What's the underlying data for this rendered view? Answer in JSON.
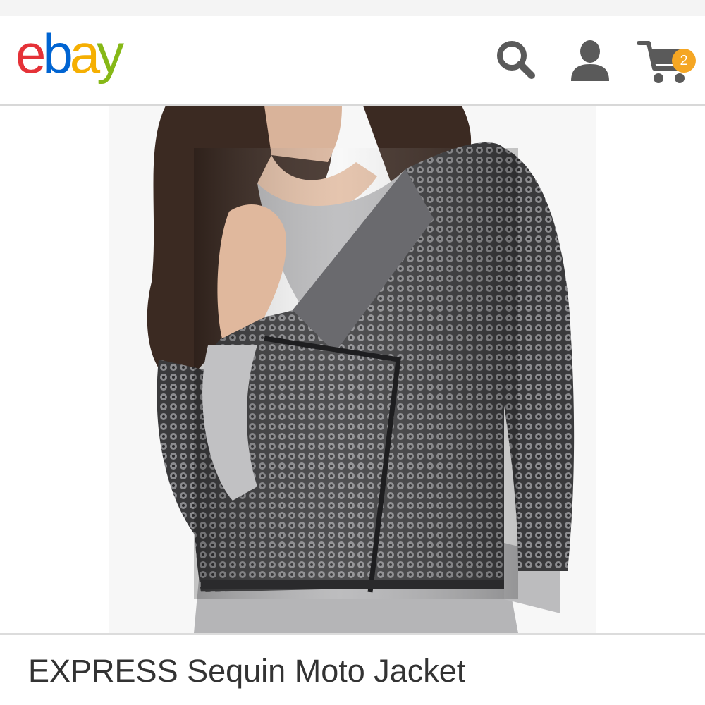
{
  "header": {
    "logo_letters": [
      "e",
      "b",
      "a",
      "y"
    ],
    "logo_colors": [
      "#e53238",
      "#0064d2",
      "#f5af02",
      "#86b817"
    ],
    "icons": [
      "search-icon",
      "user-icon",
      "cart-icon"
    ],
    "icon_color": "#5a5a5a",
    "cart_count": "2",
    "badge_color": "#f5a623"
  },
  "product": {
    "image": "product-photo",
    "title": "EXPRESS Sequin Moto Jacket"
  }
}
